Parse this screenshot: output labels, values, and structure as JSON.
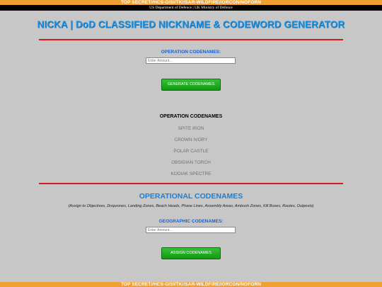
{
  "classification_banner": "TOP SECRET//HCS-O/SI/TK//SAR-WILDFIRE//ORCON/NOFORN",
  "department_bar": "US Department of Defence | UK Ministry of Defence",
  "page_title": "NICKA | DoD CLASSIFIED NICKNAME & CODEWORD GENERATOR",
  "generator": {
    "label": "OPERATION CODENAMES:",
    "input_placeholder": "Enter Amount...",
    "button_label": "GENERATE CODENAMES"
  },
  "results": {
    "heading": "OPERATION CODENAMES",
    "items": [
      "SPITE IRON",
      "CROWN IVORY",
      "POLAR CASTLE",
      "OBSIDIAN TORCH",
      "KODIAK SPECTRE"
    ]
  },
  "operational": {
    "title": "OPERATIONAL CODENAMES",
    "subtitle": "(Assign to Objectives, Dropzones, Landing Zones, Beach Heads, Phase Lines, Assembly Areas, Ambush Zones, Kill Boxes, Routes, Outposts)",
    "label": "GEOGRAPHIC CODENAMES:",
    "input_placeholder": "Enter Amount...",
    "button_label": "ASSIGN CODENAMES"
  },
  "colors": {
    "banner": "#f0a030",
    "title": "#1b8fe0",
    "rule": "#d21c1c",
    "label": "#1560d6",
    "button": "#1ea81e",
    "background": "#c7c7c7"
  }
}
